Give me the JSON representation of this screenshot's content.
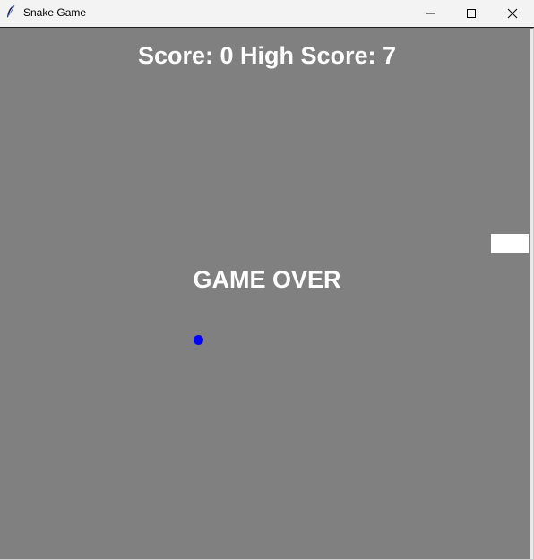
{
  "window": {
    "title": "Snake Game",
    "icon": "feather-icon",
    "controls": [
      "minimize-icon",
      "maximize-icon",
      "close-icon"
    ]
  },
  "game": {
    "score_text": "Score: 0 High Score: 7",
    "score": 0,
    "high_score": 7,
    "status_text": "GAME OVER",
    "colors": {
      "background": "#808080",
      "text": "#ffffff",
      "food": "#0000ff",
      "snake": "#ffffff"
    }
  }
}
